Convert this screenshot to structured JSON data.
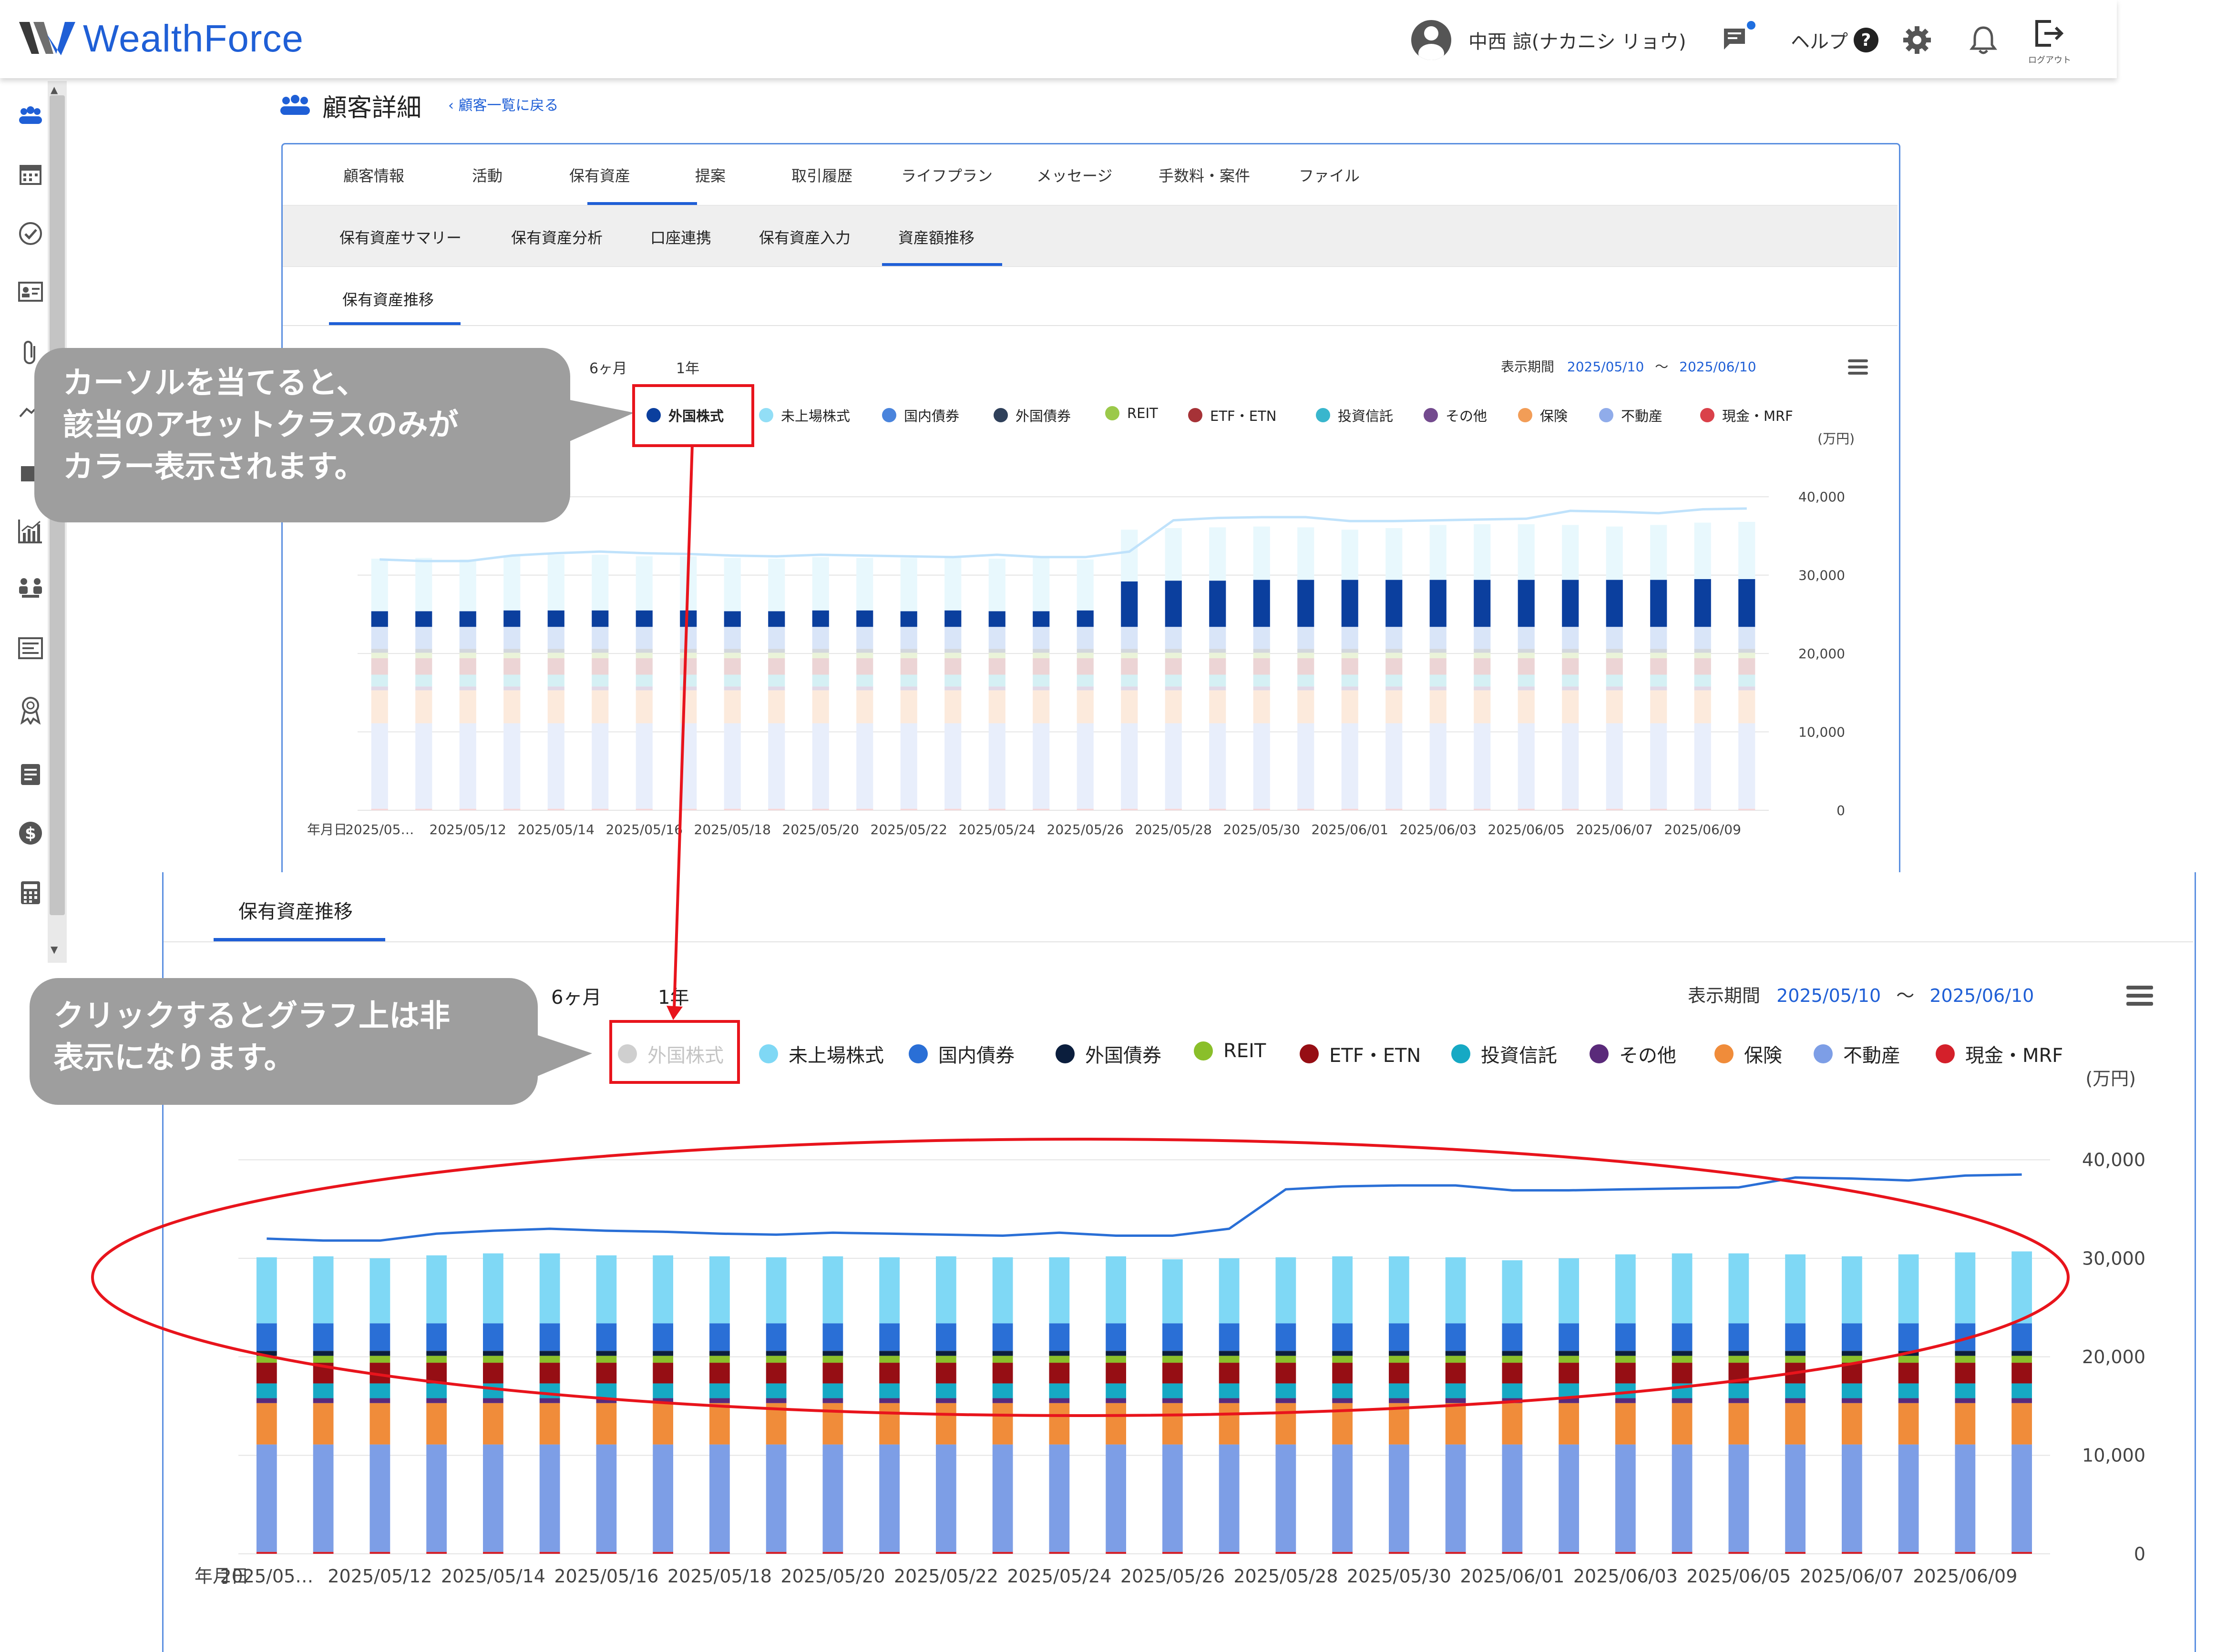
{
  "app": {
    "logo_text": "WealthForce"
  },
  "header": {
    "user_name": "中西 諒(ナカニシ リョウ)",
    "help_label": "ヘルプ",
    "logout_label": "ログアウト"
  },
  "page": {
    "title": "顧客詳細",
    "back_link": "顧客一覧に戻る"
  },
  "tabs": [
    "顧客情報",
    "活動",
    "保有資産",
    "提案",
    "取引履歴",
    "ライフプラン",
    "メッセージ",
    "手数料・案件",
    "ファイル"
  ],
  "active_tab": "保有資産",
  "subtabs": [
    "保有資産サマリー",
    "保有資産分析",
    "口座連携",
    "保有資産入力",
    "資産額推移"
  ],
  "active_subtab": "資産額推移",
  "section_tab": "保有資産推移",
  "period_buttons": [
    "6ヶ月",
    "1年"
  ],
  "display_period": {
    "label": "表示期間",
    "from": "2025/05/10",
    "separator": "～",
    "to": "2025/06/10"
  },
  "legend": [
    {
      "name": "外国株式",
      "color": "#0b3f9e"
    },
    {
      "name": "未上場株式",
      "color": "#7fd8f5"
    },
    {
      "name": "国内債券",
      "color": "#2a6fd6"
    },
    {
      "name": "外国債券",
      "color": "#0b1e3d"
    },
    {
      "name": "REIT",
      "color": "#8abf2a"
    },
    {
      "name": "ETF・ETN",
      "color": "#960e14"
    },
    {
      "name": "投資信託",
      "color": "#16a9c4"
    },
    {
      "name": "その他",
      "color": "#5a2a7a"
    },
    {
      "name": "保険",
      "color": "#f08c3a"
    },
    {
      "name": "不動産",
      "color": "#7d9ee6"
    },
    {
      "name": "現金・MRF",
      "color": "#d4202a"
    }
  ],
  "callouts": {
    "hover": [
      "カーソルを当てると、",
      "該当のアセットクラスのみが",
      "カラー表示されます。"
    ],
    "click": [
      "クリックするとグラフ上は非",
      "表示になります。"
    ]
  },
  "chart_data": [
    {
      "type": "bar",
      "title": "",
      "xlabel": "年月日",
      "ylabel": "(万円)",
      "ylim": [
        0,
        45000
      ],
      "yticks": [
        "0",
        "10,000",
        "20,000",
        "30,000",
        "40,000"
      ],
      "x_tick_labels": [
        "2025/05…",
        "2025/05/12",
        "2025/05/14",
        "2025/05/16",
        "2025/05/18",
        "2025/05/20",
        "2025/05/22",
        "2025/05/24",
        "2025/05/26",
        "2025/05/28",
        "2025/05/30",
        "2025/06/01",
        "2025/06/03",
        "2025/06/05",
        "2025/06/07",
        "2025/06/09"
      ],
      "highlighted_series": "外国株式",
      "stacked": true,
      "series_order": [
        "現金・MRF",
        "不動産",
        "保険",
        "その他",
        "投資信託",
        "ETF・ETN",
        "REIT",
        "外国債券",
        "国内債券",
        "外国株式",
        "未上場株式"
      ],
      "n_bars": 32,
      "base_values": {
        "現金・MRF": 200,
        "不動産": 10900,
        "保険": 4200,
        "その他": 500,
        "投資信託": 1500,
        "ETF・ETN": 2100,
        "REIT": 700,
        "外国債券": 500,
        "国内債券": 2800
      },
      "foreign_equity_values": [
        2000,
        2000,
        2000,
        2100,
        2100,
        2100,
        2100,
        2100,
        2000,
        2000,
        2100,
        2100,
        2000,
        2100,
        2000,
        2000,
        2100,
        5800,
        5900,
        5900,
        6000,
        6000,
        6000,
        6000,
        6000,
        6000,
        6000,
        6000,
        6000,
        6000,
        6100,
        6100
      ],
      "unlisted_equity_values": [
        6700,
        6800,
        6600,
        6900,
        7100,
        7100,
        6900,
        6900,
        6800,
        6700,
        6800,
        6700,
        6800,
        6700,
        6700,
        6800,
        6500,
        6600,
        6700,
        6800,
        6800,
        6700,
        6400,
        6600,
        7000,
        7100,
        7100,
        7000,
        6800,
        7000,
        7200,
        7300
      ],
      "total_line_values": [
        32000,
        31800,
        31800,
        32500,
        32800,
        33000,
        32800,
        32700,
        32500,
        32400,
        32600,
        32500,
        32400,
        32300,
        32600,
        32300,
        32300,
        33000,
        37000,
        37300,
        37400,
        37400,
        36900,
        36900,
        37000,
        37100,
        37200,
        38200,
        38100,
        37900,
        38400,
        38500
      ]
    },
    {
      "type": "bar",
      "title": "",
      "xlabel": "年月日",
      "ylabel": "(万円)",
      "ylim": [
        0,
        45000
      ],
      "yticks": [
        "0",
        "10,000",
        "20,000",
        "30,000",
        "40,000"
      ],
      "hidden_series": "外国株式",
      "stacked": true,
      "x_tick_labels": [
        "2025/05…",
        "2025/05/12",
        "2025/05/14",
        "2025/05/16",
        "2025/05/18",
        "2025/05/20",
        "2025/05/22",
        "2025/05/24",
        "2025/05/26",
        "2025/05/28",
        "2025/05/30",
        "2025/06/01",
        "2025/06/03",
        "2025/06/05",
        "2025/06/07",
        "2025/06/09"
      ]
    }
  ]
}
